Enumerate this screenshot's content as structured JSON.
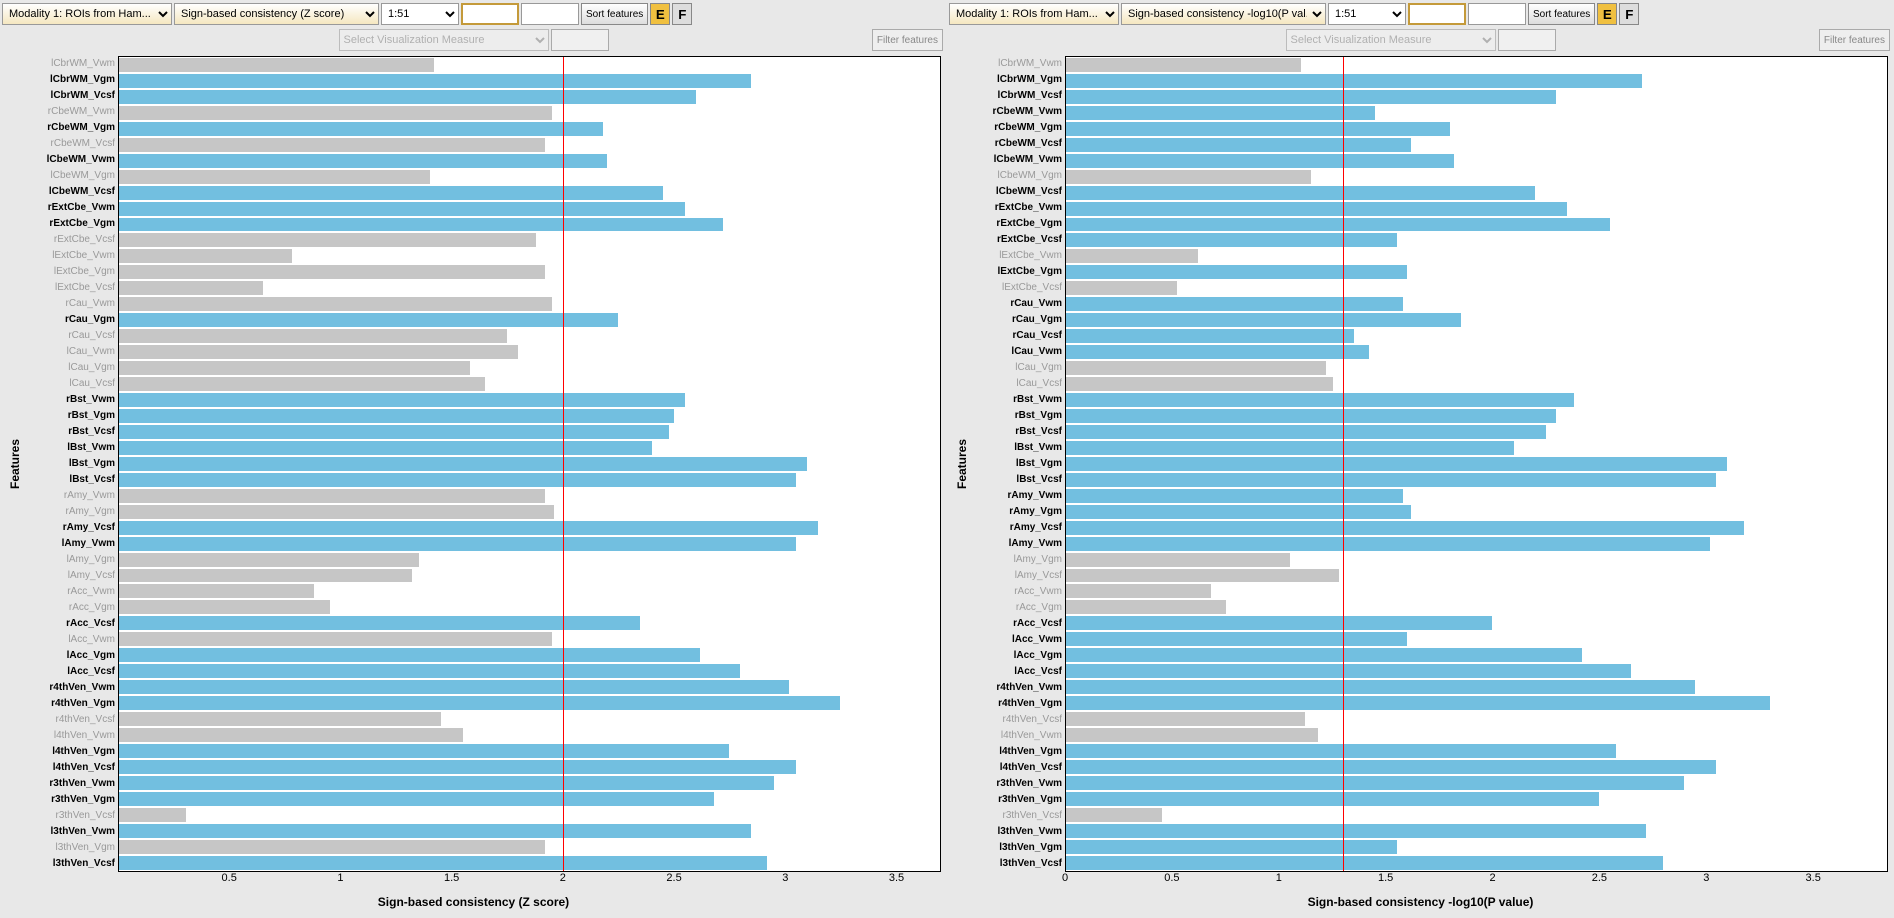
{
  "panels": [
    {
      "toolbar": {
        "modality": "Modality 1: ROIs from Ham...",
        "metric": "Sign-based consistency (Z score)",
        "range": "1:51",
        "input_a": "",
        "input_b": "",
        "sort": "Sort features",
        "e": "E",
        "f": "F",
        "viz_placeholder": "Select Visualization Measure",
        "filter": "Filter features"
      },
      "ylabel": "Features",
      "xlabel": "Sign-based consistency (Z score)"
    },
    {
      "toolbar": {
        "modality": "Modality 1: ROIs from Ham...",
        "metric": "Sign-based consistency -log10(P val...",
        "range": "1:51",
        "input_a": "",
        "input_b": "",
        "sort": "Sort features",
        "e": "E",
        "f": "F",
        "viz_placeholder": "Select Visualization Measure",
        "filter": "Filter features"
      },
      "ylabel": "Features",
      "xlabel": "Sign-based consistency -log10(P value)"
    }
  ],
  "chart_data": [
    {
      "type": "bar",
      "orientation": "horizontal",
      "xlabel": "Sign-based consistency (Z score)",
      "ylabel": "Features",
      "xlim": [
        0,
        3.7
      ],
      "threshold": 2.0,
      "xticks": [
        0.5,
        1,
        1.5,
        2,
        2.5,
        3,
        3.5
      ],
      "features": [
        {
          "name": "lCbrWM_Vwm",
          "value": 1.42,
          "sig": false
        },
        {
          "name": "lCbrWM_Vgm",
          "value": 2.85,
          "sig": true
        },
        {
          "name": "lCbrWM_Vcsf",
          "value": 2.6,
          "sig": true
        },
        {
          "name": "rCbeWM_Vwm",
          "value": 1.95,
          "sig": false
        },
        {
          "name": "rCbeWM_Vgm",
          "value": 2.18,
          "sig": true
        },
        {
          "name": "rCbeWM_Vcsf",
          "value": 1.92,
          "sig": false
        },
        {
          "name": "lCbeWM_Vwm",
          "value": 2.2,
          "sig": true
        },
        {
          "name": "lCbeWM_Vgm",
          "value": 1.4,
          "sig": false
        },
        {
          "name": "lCbeWM_Vcsf",
          "value": 2.45,
          "sig": true
        },
        {
          "name": "rExtCbe_Vwm",
          "value": 2.55,
          "sig": true
        },
        {
          "name": "rExtCbe_Vgm",
          "value": 2.72,
          "sig": true
        },
        {
          "name": "rExtCbe_Vcsf",
          "value": 1.88,
          "sig": false
        },
        {
          "name": "lExtCbe_Vwm",
          "value": 0.78,
          "sig": false
        },
        {
          "name": "lExtCbe_Vgm",
          "value": 1.92,
          "sig": false
        },
        {
          "name": "lExtCbe_Vcsf",
          "value": 0.65,
          "sig": false
        },
        {
          "name": "rCau_Vwm",
          "value": 1.95,
          "sig": false
        },
        {
          "name": "rCau_Vgm",
          "value": 2.25,
          "sig": true
        },
        {
          "name": "rCau_Vcsf",
          "value": 1.75,
          "sig": false
        },
        {
          "name": "lCau_Vwm",
          "value": 1.8,
          "sig": false
        },
        {
          "name": "lCau_Vgm",
          "value": 1.58,
          "sig": false
        },
        {
          "name": "lCau_Vcsf",
          "value": 1.65,
          "sig": false
        },
        {
          "name": "rBst_Vwm",
          "value": 2.55,
          "sig": true
        },
        {
          "name": "rBst_Vgm",
          "value": 2.5,
          "sig": true
        },
        {
          "name": "rBst_Vcsf",
          "value": 2.48,
          "sig": true
        },
        {
          "name": "lBst_Vwm",
          "value": 2.4,
          "sig": true
        },
        {
          "name": "lBst_Vgm",
          "value": 3.1,
          "sig": true
        },
        {
          "name": "lBst_Vcsf",
          "value": 3.05,
          "sig": true
        },
        {
          "name": "rAmy_Vwm",
          "value": 1.92,
          "sig": false
        },
        {
          "name": "rAmy_Vgm",
          "value": 1.96,
          "sig": false
        },
        {
          "name": "rAmy_Vcsf",
          "value": 3.15,
          "sig": true
        },
        {
          "name": "lAmy_Vwm",
          "value": 3.05,
          "sig": true
        },
        {
          "name": "lAmy_Vgm",
          "value": 1.35,
          "sig": false
        },
        {
          "name": "lAmy_Vcsf",
          "value": 1.32,
          "sig": false
        },
        {
          "name": "rAcc_Vwm",
          "value": 0.88,
          "sig": false
        },
        {
          "name": "rAcc_Vgm",
          "value": 0.95,
          "sig": false
        },
        {
          "name": "rAcc_Vcsf",
          "value": 2.35,
          "sig": true
        },
        {
          "name": "lAcc_Vwm",
          "value": 1.95,
          "sig": false
        },
        {
          "name": "lAcc_Vgm",
          "value": 2.62,
          "sig": true
        },
        {
          "name": "lAcc_Vcsf",
          "value": 2.8,
          "sig": true
        },
        {
          "name": "r4thVen_Vwm",
          "value": 3.02,
          "sig": true
        },
        {
          "name": "r4thVen_Vgm",
          "value": 3.25,
          "sig": true
        },
        {
          "name": "r4thVen_Vcsf",
          "value": 1.45,
          "sig": false
        },
        {
          "name": "l4thVen_Vwm",
          "value": 1.55,
          "sig": false
        },
        {
          "name": "l4thVen_Vgm",
          "value": 2.75,
          "sig": true
        },
        {
          "name": "l4thVen_Vcsf",
          "value": 3.05,
          "sig": true
        },
        {
          "name": "r3thVen_Vwm",
          "value": 2.95,
          "sig": true
        },
        {
          "name": "r3thVen_Vgm",
          "value": 2.68,
          "sig": true
        },
        {
          "name": "r3thVen_Vcsf",
          "value": 0.3,
          "sig": false
        },
        {
          "name": "l3thVen_Vwm",
          "value": 2.85,
          "sig": true
        },
        {
          "name": "l3thVen_Vgm",
          "value": 1.92,
          "sig": false
        },
        {
          "name": "l3thVen_Vcsf",
          "value": 2.92,
          "sig": true
        }
      ]
    },
    {
      "type": "bar",
      "orientation": "horizontal",
      "xlabel": "Sign-based consistency -log10(P value)",
      "ylabel": "Features",
      "xlim": [
        0,
        3.85
      ],
      "threshold": 1.3,
      "xticks": [
        0,
        0.5,
        1,
        1.5,
        2,
        2.5,
        3,
        3.5
      ],
      "features": [
        {
          "name": "lCbrWM_Vwm",
          "value": 1.1,
          "sig": false
        },
        {
          "name": "lCbrWM_Vgm",
          "value": 2.7,
          "sig": true
        },
        {
          "name": "lCbrWM_Vcsf",
          "value": 2.3,
          "sig": true
        },
        {
          "name": "rCbeWM_Vwm",
          "value": 1.45,
          "sig": true
        },
        {
          "name": "rCbeWM_Vgm",
          "value": 1.8,
          "sig": true
        },
        {
          "name": "rCbeWM_Vcsf",
          "value": 1.62,
          "sig": true
        },
        {
          "name": "lCbeWM_Vwm",
          "value": 1.82,
          "sig": true
        },
        {
          "name": "lCbeWM_Vgm",
          "value": 1.15,
          "sig": false
        },
        {
          "name": "lCbeWM_Vcsf",
          "value": 2.2,
          "sig": true
        },
        {
          "name": "rExtCbe_Vwm",
          "value": 2.35,
          "sig": true
        },
        {
          "name": "rExtCbe_Vgm",
          "value": 2.55,
          "sig": true
        },
        {
          "name": "rExtCbe_Vcsf",
          "value": 1.55,
          "sig": true
        },
        {
          "name": "lExtCbe_Vwm",
          "value": 0.62,
          "sig": false
        },
        {
          "name": "lExtCbe_Vgm",
          "value": 1.6,
          "sig": true
        },
        {
          "name": "lExtCbe_Vcsf",
          "value": 0.52,
          "sig": false
        },
        {
          "name": "rCau_Vwm",
          "value": 1.58,
          "sig": true
        },
        {
          "name": "rCau_Vgm",
          "value": 1.85,
          "sig": true
        },
        {
          "name": "rCau_Vcsf",
          "value": 1.35,
          "sig": true
        },
        {
          "name": "lCau_Vwm",
          "value": 1.42,
          "sig": true
        },
        {
          "name": "lCau_Vgm",
          "value": 1.22,
          "sig": false
        },
        {
          "name": "lCau_Vcsf",
          "value": 1.25,
          "sig": false
        },
        {
          "name": "rBst_Vwm",
          "value": 2.38,
          "sig": true
        },
        {
          "name": "rBst_Vgm",
          "value": 2.3,
          "sig": true
        },
        {
          "name": "rBst_Vcsf",
          "value": 2.25,
          "sig": true
        },
        {
          "name": "lBst_Vwm",
          "value": 2.1,
          "sig": true
        },
        {
          "name": "lBst_Vgm",
          "value": 3.1,
          "sig": true
        },
        {
          "name": "lBst_Vcsf",
          "value": 3.05,
          "sig": true
        },
        {
          "name": "rAmy_Vwm",
          "value": 1.58,
          "sig": true
        },
        {
          "name": "rAmy_Vgm",
          "value": 1.62,
          "sig": true
        },
        {
          "name": "rAmy_Vcsf",
          "value": 3.18,
          "sig": true
        },
        {
          "name": "lAmy_Vwm",
          "value": 3.02,
          "sig": true
        },
        {
          "name": "lAmy_Vgm",
          "value": 1.05,
          "sig": false
        },
        {
          "name": "lAmy_Vcsf",
          "value": 1.28,
          "sig": false
        },
        {
          "name": "rAcc_Vwm",
          "value": 0.68,
          "sig": false
        },
        {
          "name": "rAcc_Vgm",
          "value": 0.75,
          "sig": false
        },
        {
          "name": "rAcc_Vcsf",
          "value": 2.0,
          "sig": true
        },
        {
          "name": "lAcc_Vwm",
          "value": 1.6,
          "sig": true
        },
        {
          "name": "lAcc_Vgm",
          "value": 2.42,
          "sig": true
        },
        {
          "name": "lAcc_Vcsf",
          "value": 2.65,
          "sig": true
        },
        {
          "name": "r4thVen_Vwm",
          "value": 2.95,
          "sig": true
        },
        {
          "name": "r4thVen_Vgm",
          "value": 3.3,
          "sig": true
        },
        {
          "name": "r4thVen_Vcsf",
          "value": 1.12,
          "sig": false
        },
        {
          "name": "l4thVen_Vwm",
          "value": 1.18,
          "sig": false
        },
        {
          "name": "l4thVen_Vgm",
          "value": 2.58,
          "sig": true
        },
        {
          "name": "l4thVen_Vcsf",
          "value": 3.05,
          "sig": true
        },
        {
          "name": "r3thVen_Vwm",
          "value": 2.9,
          "sig": true
        },
        {
          "name": "r3thVen_Vgm",
          "value": 2.5,
          "sig": true
        },
        {
          "name": "r3thVen_Vcsf",
          "value": 0.45,
          "sig": false
        },
        {
          "name": "l3thVen_Vwm",
          "value": 2.72,
          "sig": true
        },
        {
          "name": "l3thVen_Vgm",
          "value": 1.55,
          "sig": true
        },
        {
          "name": "l3thVen_Vcsf",
          "value": 2.8,
          "sig": true
        }
      ]
    }
  ]
}
